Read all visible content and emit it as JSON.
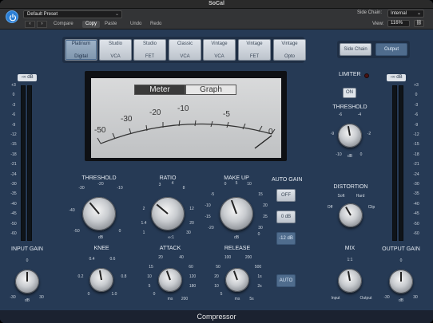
{
  "window": {
    "title": "SoCal"
  },
  "header": {
    "preset": "Default Preset",
    "compare": "Compare",
    "copy": "Copy",
    "paste": "Paste",
    "undo": "Undo",
    "redo": "Redo",
    "side_chain_label": "Side Chain:",
    "side_chain_value": "Internal",
    "view_label": "View:",
    "view_value": "116%"
  },
  "models": [
    {
      "line1": "Platinum",
      "line2": "Digital",
      "selected": true
    },
    {
      "line1": "Studio",
      "line2": "VCA"
    },
    {
      "line1": "Studio",
      "line2": "FET"
    },
    {
      "line1": "Classic",
      "line2": "VCA"
    },
    {
      "line1": "Vintage",
      "line2": "VCA"
    },
    {
      "line1": "Vintage",
      "line2": "FET"
    },
    {
      "line1": "Vintage",
      "line2": "Opto"
    }
  ],
  "side_chain_btn": "Side Chain",
  "output_btn": "Output",
  "meter": {
    "tab_meter": "Meter",
    "tab_graph": "Graph",
    "scale": [
      "-50",
      "-30",
      "-20",
      "-10",
      "-5",
      "0"
    ]
  },
  "input_meter": {
    "readout": "-∞ dB",
    "ticks": [
      "+3",
      "0",
      "-3",
      "-6",
      "-9",
      "-12",
      "-15",
      "-18",
      "-21",
      "-24",
      "-30",
      "-35",
      "-40",
      "-45",
      "-50",
      "-60"
    ]
  },
  "output_meter": {
    "readout": "-∞ dB",
    "ticks": [
      "+3",
      "0",
      "-3",
      "-6",
      "-9",
      "-12",
      "-15",
      "-18",
      "-21",
      "-24",
      "-30",
      "-35",
      "-40",
      "-45",
      "-50",
      "-60"
    ]
  },
  "knobs": {
    "threshold": {
      "label": "THRESHOLD",
      "ticks": [
        "-30",
        "-20",
        "-10",
        "-40",
        "-50",
        "dB",
        "0"
      ]
    },
    "ratio": {
      "label": "RATIO",
      "ticks": [
        "3",
        "4",
        "8",
        "2",
        "12",
        "1.4",
        "20",
        "1",
        "30",
        "∞:1"
      ]
    },
    "makeup": {
      "label": "MAKE UP",
      "ticks": [
        "0",
        "5",
        "10",
        "-5",
        "15",
        "-10",
        "20",
        "-15",
        "25",
        "-20",
        "30",
        "dB",
        "0"
      ]
    },
    "knee": {
      "label": "KNEE",
      "ticks": [
        "0.4",
        "0.6",
        "0.2",
        "0.8",
        "0",
        "1.0"
      ]
    },
    "attack": {
      "label": "ATTACK",
      "ticks": [
        "20",
        "40",
        "15",
        "60",
        "10",
        "120",
        "5",
        "180",
        "0",
        "ms",
        "200"
      ]
    },
    "release": {
      "label": "RELEASE",
      "ticks": [
        "100",
        "200",
        "50",
        "500",
        "20",
        "1s",
        "10",
        "2s",
        "5",
        "ms",
        "5s"
      ]
    },
    "input_gain": {
      "label": "INPUT GAIN",
      "ticks": [
        "0",
        "-30",
        "dB",
        "30"
      ]
    },
    "output_gain": {
      "label": "OUTPUT GAIN",
      "ticks": [
        "0",
        "-30",
        "dB",
        "30"
      ]
    },
    "limiter_threshold": {
      "label": "THRESHOLD",
      "ticks": [
        "-6",
        "-4",
        "-9",
        "-2",
        "-10",
        "dB",
        "0"
      ]
    },
    "distortion": {
      "label": "DISTORTION",
      "ticks": [
        "Soft",
        "Hard",
        "Off",
        "Clip"
      ]
    },
    "mix": {
      "label": "MIX",
      "ticks": [
        "1:1",
        "Input",
        "Output"
      ]
    }
  },
  "auto_gain": {
    "label": "AUTO GAIN",
    "off": "OFF",
    "zero": "0 dB",
    "minus12": "-12 dB"
  },
  "auto_btn": "AUTO",
  "limiter": {
    "label": "LIMITER",
    "on": "ON"
  },
  "footer": "Compressor"
}
